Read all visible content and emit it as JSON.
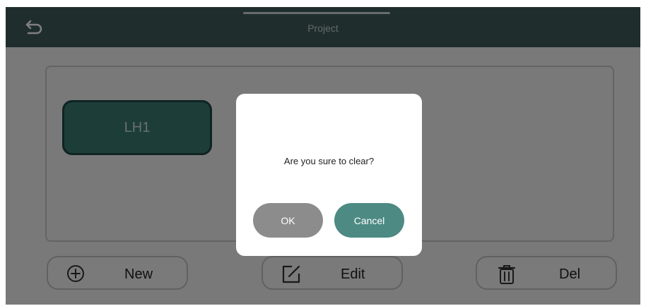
{
  "header": {
    "title": "Project",
    "back_icon": "back-arrow-icon"
  },
  "projects": [
    {
      "label": "LH1"
    }
  ],
  "actions": {
    "new_label": "New",
    "edit_label": "Edit",
    "del_label": "Del"
  },
  "dialog": {
    "message": "Are you sure to clear?",
    "ok_label": "OK",
    "cancel_label": "Cancel"
  },
  "colors": {
    "header": "#3f5b5a",
    "accent": "#3a7a73",
    "cancel_button": "#4d8a84",
    "ok_button": "#8c8c8c"
  }
}
